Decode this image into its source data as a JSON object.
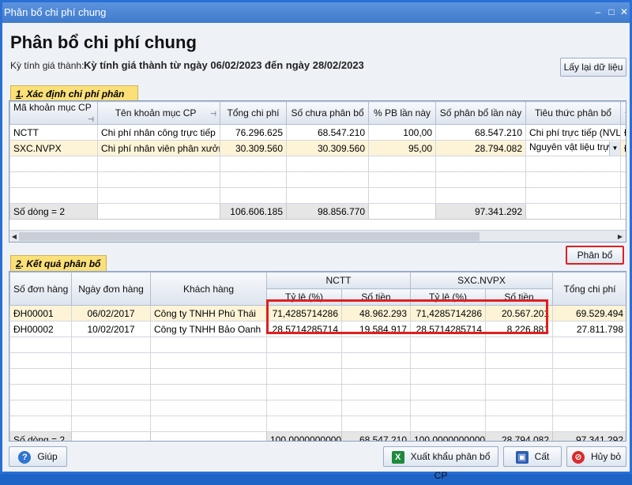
{
  "window": {
    "title": "Phân bổ chi phí chung"
  },
  "header": {
    "title": "Phân bổ chi phí chung",
    "period_label": "Kỳ tính giá thành:",
    "period_value": "Kỳ tính giá thành từ ngày 06/02/2023 đến ngày 28/02/2023",
    "reload_label": "Lấy lại dữ liệu"
  },
  "section1": {
    "num": "1",
    "title": ". Xác định chi phí phân bổ",
    "columns": [
      "Mã khoản mục CP",
      "Tên khoản mục CP",
      "Tổng chi phí",
      "Số chưa phân bổ",
      "% PB lần này",
      "Số phân bổ lần này",
      "Tiêu thức phân bổ",
      "Đ"
    ],
    "rows": [
      [
        "NCTT",
        "Chi phí nhân công trực tiếp",
        "76.296.625",
        "68.547.210",
        "100,00",
        "68.547.210",
        "Chi phí trực tiếp (NVL",
        "Đ"
      ],
      [
        "SXC.NVPX",
        "Chi phí nhân viên phân xưởn",
        "30.309.560",
        "30.309.560",
        "95,00",
        "28.794.082",
        "Nguyên vật liệu trự",
        "Đ"
      ]
    ],
    "footer": [
      "Số dòng = 2",
      "",
      "106.606.185",
      "98.856.770",
      "",
      "97.341.292",
      "",
      ""
    ]
  },
  "allocate_label": "Phân bổ",
  "section2": {
    "num": "2",
    "title": ". Kết quả phân bổ",
    "columns": {
      "order_no": "Số đơn hàng",
      "order_date": "Ngày đơn hàng",
      "customer": "Khách hàng",
      "group1": "NCTT",
      "group2": "SXC.NVPX",
      "rate": "Tỷ lệ (%)",
      "amount": "Số tiền",
      "total": "Tổng chi phí"
    },
    "rows": [
      [
        "ĐH00001",
        "06/02/2017",
        "Công ty TNHH Phú Thái",
        "71,4285714286",
        "48.962.293",
        "71,4285714286",
        "20.567.201",
        "69.529.494"
      ],
      [
        "ĐH00002",
        "10/02/2017",
        "Công ty TNHH Bảo Oanh",
        "28,5714285714",
        "19.584.917",
        "28,5714285714",
        "8.226.881",
        "27.811.798"
      ]
    ],
    "footer": [
      "Số dòng = 2",
      "",
      "",
      "100,0000000000",
      "68.547.210",
      "100,0000000000",
      "28.794.082",
      "97.341.292"
    ]
  },
  "buttons": {
    "help": "Giúp",
    "export": "Xuất khẩu phân bổ CP",
    "save": "Cất",
    "cancel": "Hủy bỏ"
  },
  "icons": {
    "minimize": "minimize-icon",
    "maximize": "maximize-icon",
    "close": "close-icon",
    "pin": "pin-icon",
    "dropdown": "chevron-down-icon",
    "help": "help-icon",
    "excel": "excel-icon",
    "save": "save-icon",
    "cancel": "cancel-icon"
  },
  "colors": {
    "title_bar": "#3f7acc",
    "section_tab": "#fbe07a",
    "selected_row": "#fdf4d7",
    "highlight": "#e02020"
  }
}
